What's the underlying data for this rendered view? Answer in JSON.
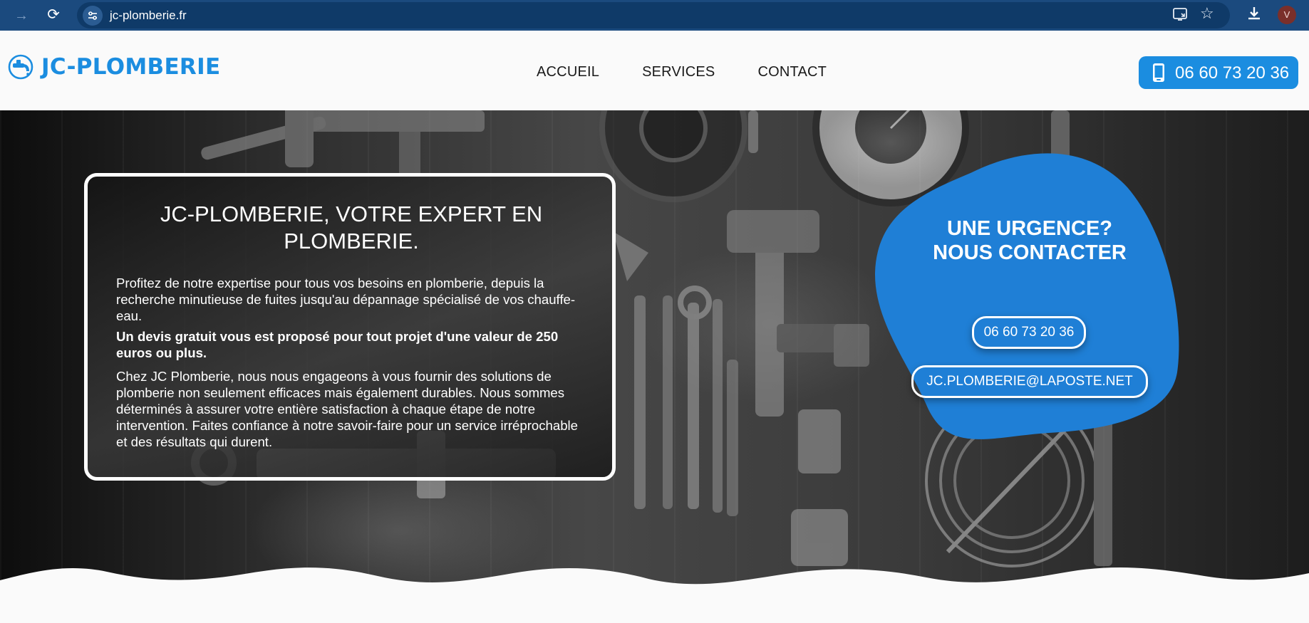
{
  "browser": {
    "url": "jc-plomberie.fr",
    "avatar_initial": "V"
  },
  "header": {
    "brand": "JC-PLOMBERIE",
    "nav": [
      "ACCUEIL",
      "SERVICES",
      "CONTACT"
    ],
    "phone": "06 60 73 20 36"
  },
  "hero": {
    "title": "JC-PLOMBERIE, VOTRE EXPERT EN PLOMBERIE.",
    "paragraph1": "Profitez de notre expertise pour tous vos besoins en plomberie, depuis la recherche minutieuse de fuites jusqu'au dépannage spécialisé de vos chauffe-eau.",
    "paragraph2": "Un devis gratuit vous est proposé pour tout projet d'une valeur de 250 euros ou plus.",
    "paragraph3": "Chez JC Plomberie, nous nous engageons à vous fournir des solutions de plomberie non seulement efficaces mais également durables. Nous sommes déterminés à assurer votre entière satisfaction à chaque étape de notre intervention. Faites confiance à notre savoir-faire pour un service irréprochable et des résultats qui durent."
  },
  "urgency": {
    "line1": "UNE URGENCE?",
    "line2": "NOUS CONTACTER",
    "phone": "06 60 73 20 36",
    "email": "JC.PLOMBERIE@LAPOSTE.NET"
  },
  "colors": {
    "brand_blue": "#1b8de0",
    "blob_blue": "#1f7fd6",
    "browser_bar": "#1b4a7e"
  },
  "icons": {
    "forward": "arrow-forward-icon",
    "reload": "reload-icon",
    "site_info": "tune-icon",
    "cast": "cast-icon",
    "bookmark": "star-icon",
    "download": "download-icon",
    "brand": "faucet-logo-icon",
    "phone": "mobile-phone-icon"
  }
}
